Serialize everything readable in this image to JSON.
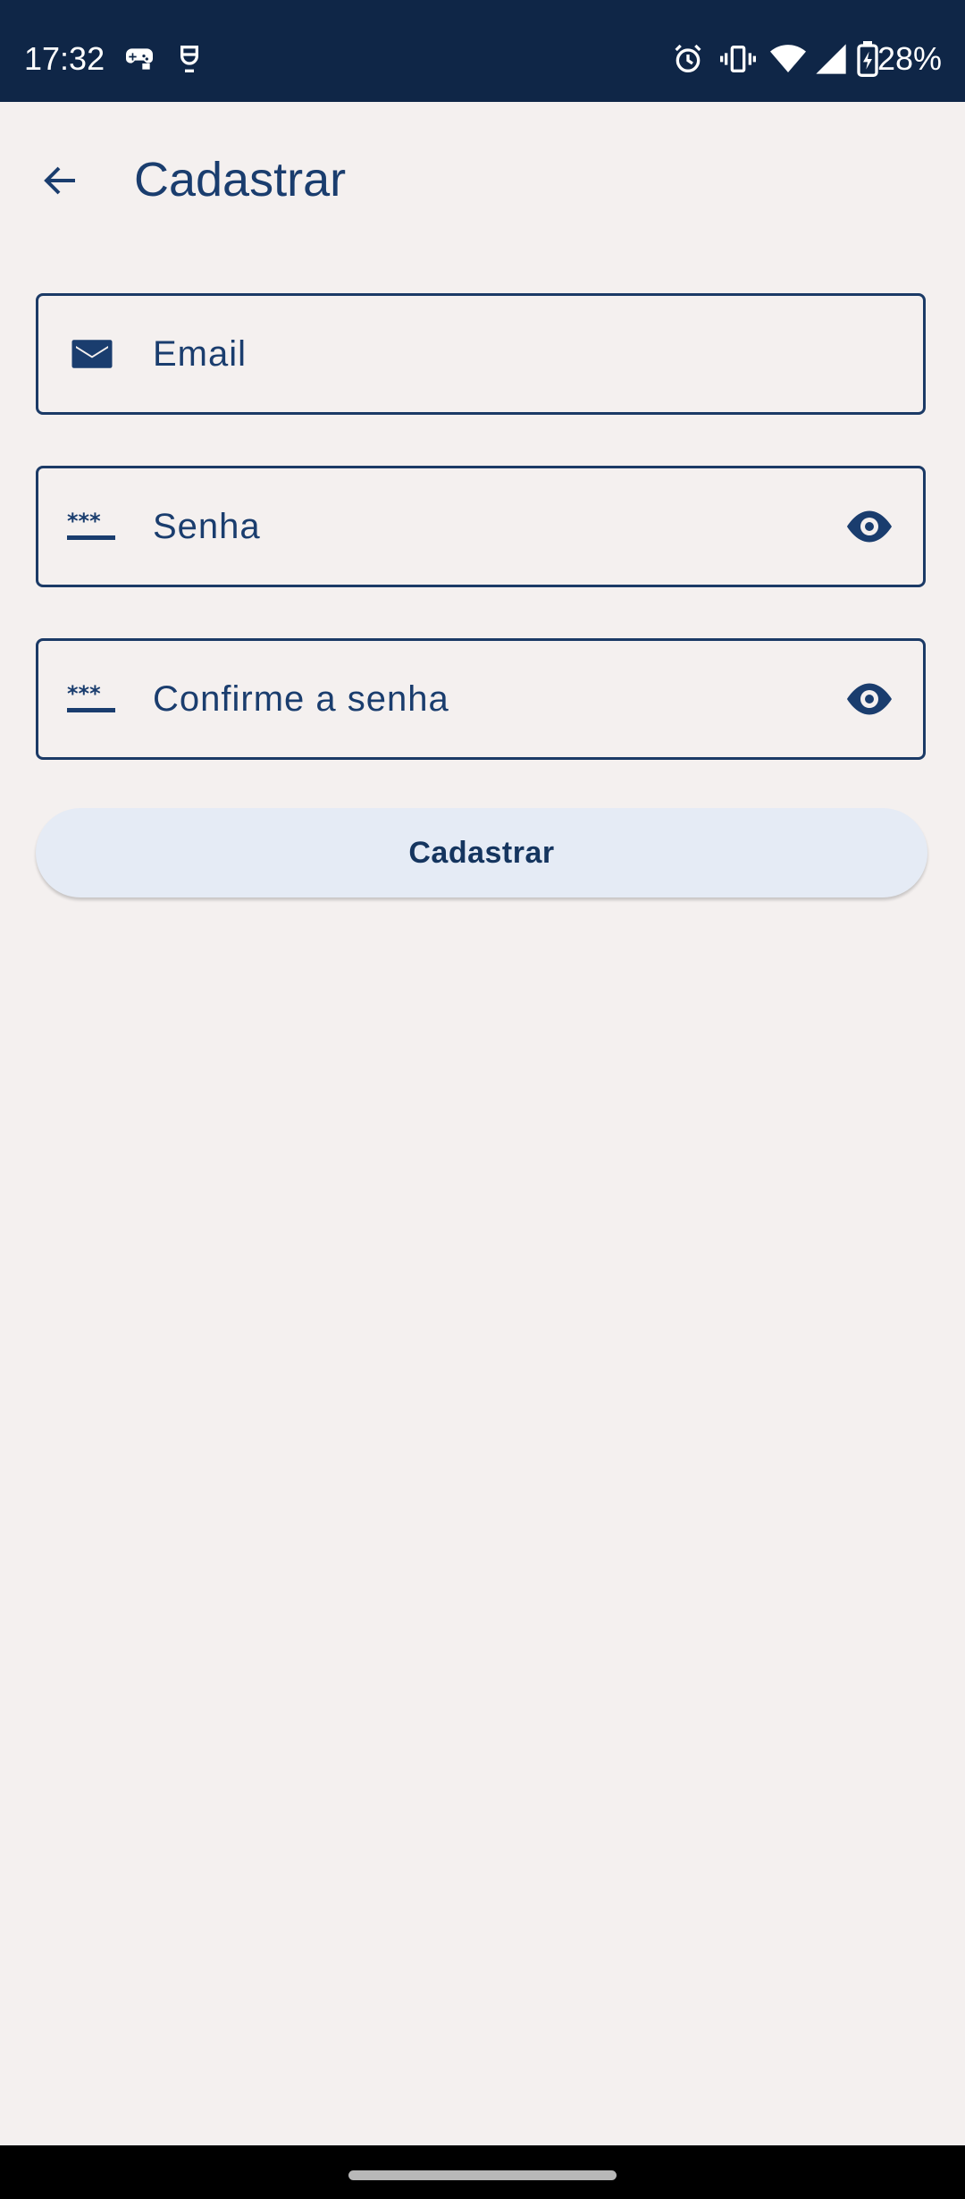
{
  "status_bar": {
    "time": "17:32",
    "battery_percent": "28%",
    "icons": [
      "game-controller-icon",
      "robot-icon",
      "alarm-icon",
      "vibrate-icon",
      "wifi-icon",
      "signal-icon",
      "battery-charging-icon"
    ],
    "background": "#0f2647"
  },
  "app_bar": {
    "title": "Cadastrar",
    "back_icon": "arrow-back-icon"
  },
  "form": {
    "email": {
      "placeholder": "Email",
      "value": "",
      "icon": "email-icon"
    },
    "password": {
      "placeholder": "Senha",
      "value": "",
      "icon": "password-icon",
      "toggle_icon": "eye-icon"
    },
    "confirm_password": {
      "placeholder": "Confirme a senha",
      "value": "",
      "icon": "password-icon",
      "toggle_icon": "eye-icon"
    },
    "submit_label": "Cadastrar"
  },
  "colors": {
    "accent": "#1a3d6e",
    "background": "#f4f0ef",
    "button_background": "#e5ebf5"
  }
}
